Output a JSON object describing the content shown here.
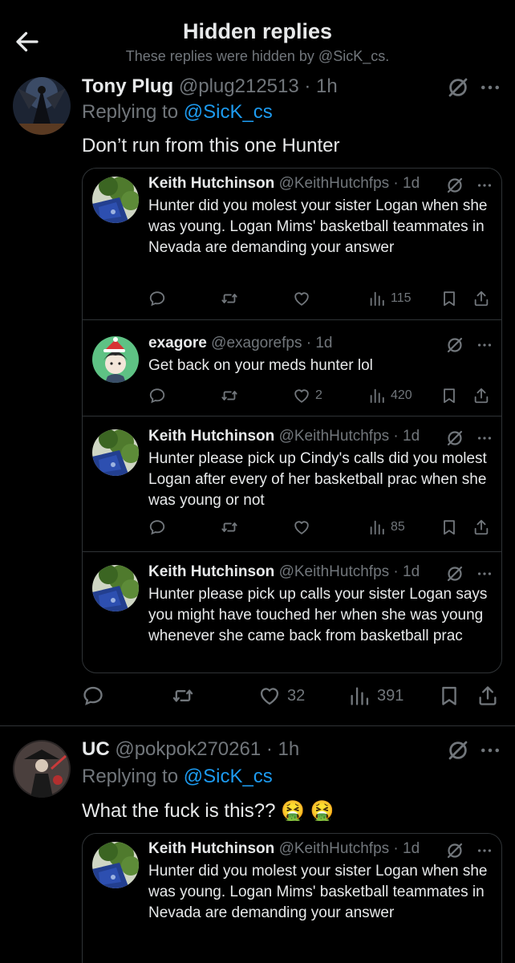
{
  "header": {
    "title": "Hidden replies",
    "subtitle": "These replies were hidden by @SicK_cs."
  },
  "posts": [
    {
      "name": "Tony Plug",
      "handle": "@plug212513",
      "time": "· 1h",
      "replying_prefix": "Replying to ",
      "replying_to": "@SicK_cs",
      "text": "Don’t run from this one Hunter",
      "stats": {
        "likes": "32",
        "views": "391"
      },
      "quotes": [
        {
          "name": "Keith Hutchinson",
          "handle": "@KeithHutchfps",
          "time": "· 1d",
          "text": "Hunter did you molest your sister Logan when she was young. Logan Mims' basketball teammates in Nevada are demanding your answer",
          "likes": "",
          "views": "115"
        },
        {
          "name": "exagore",
          "handle": "@exagorefps",
          "time": "· 1d",
          "text": "Get back on your meds hunter lol",
          "likes": "2",
          "views": "420"
        },
        {
          "name": "Keith Hutchinson",
          "handle": "@KeithHutchfps",
          "time": "· 1d",
          "text": "Hunter please pick up Cindy's calls did you molest Logan after every of her basketball prac when she was young or not",
          "likes": "",
          "views": "85"
        },
        {
          "name": "Keith Hutchinson",
          "handle": "@KeithHutchfps",
          "time": "· 1d",
          "text": "Hunter please pick up calls your sister Logan says you might have touched her when she was young whenever she came back from basketball prac"
        }
      ]
    },
    {
      "name": "UC",
      "handle": "@pokpok270261",
      "time": "· 1h",
      "replying_prefix": "Replying to ",
      "replying_to": "@SicK_cs",
      "text": "What the fuck is this?? 🤮 🤮",
      "quotes": [
        {
          "name": "Keith Hutchinson",
          "handle": "@KeithHutchfps",
          "time": "· 1d",
          "text": "Hunter did you molest your sister Logan when she was young. Logan Mims' basketball teammates in Nevada are demanding your answer"
        }
      ]
    }
  ],
  "colors": {
    "background": "#000000",
    "text": "#e7e9ea",
    "muted": "#71767b",
    "link": "#1d9bf0",
    "border": "#2f3336"
  }
}
